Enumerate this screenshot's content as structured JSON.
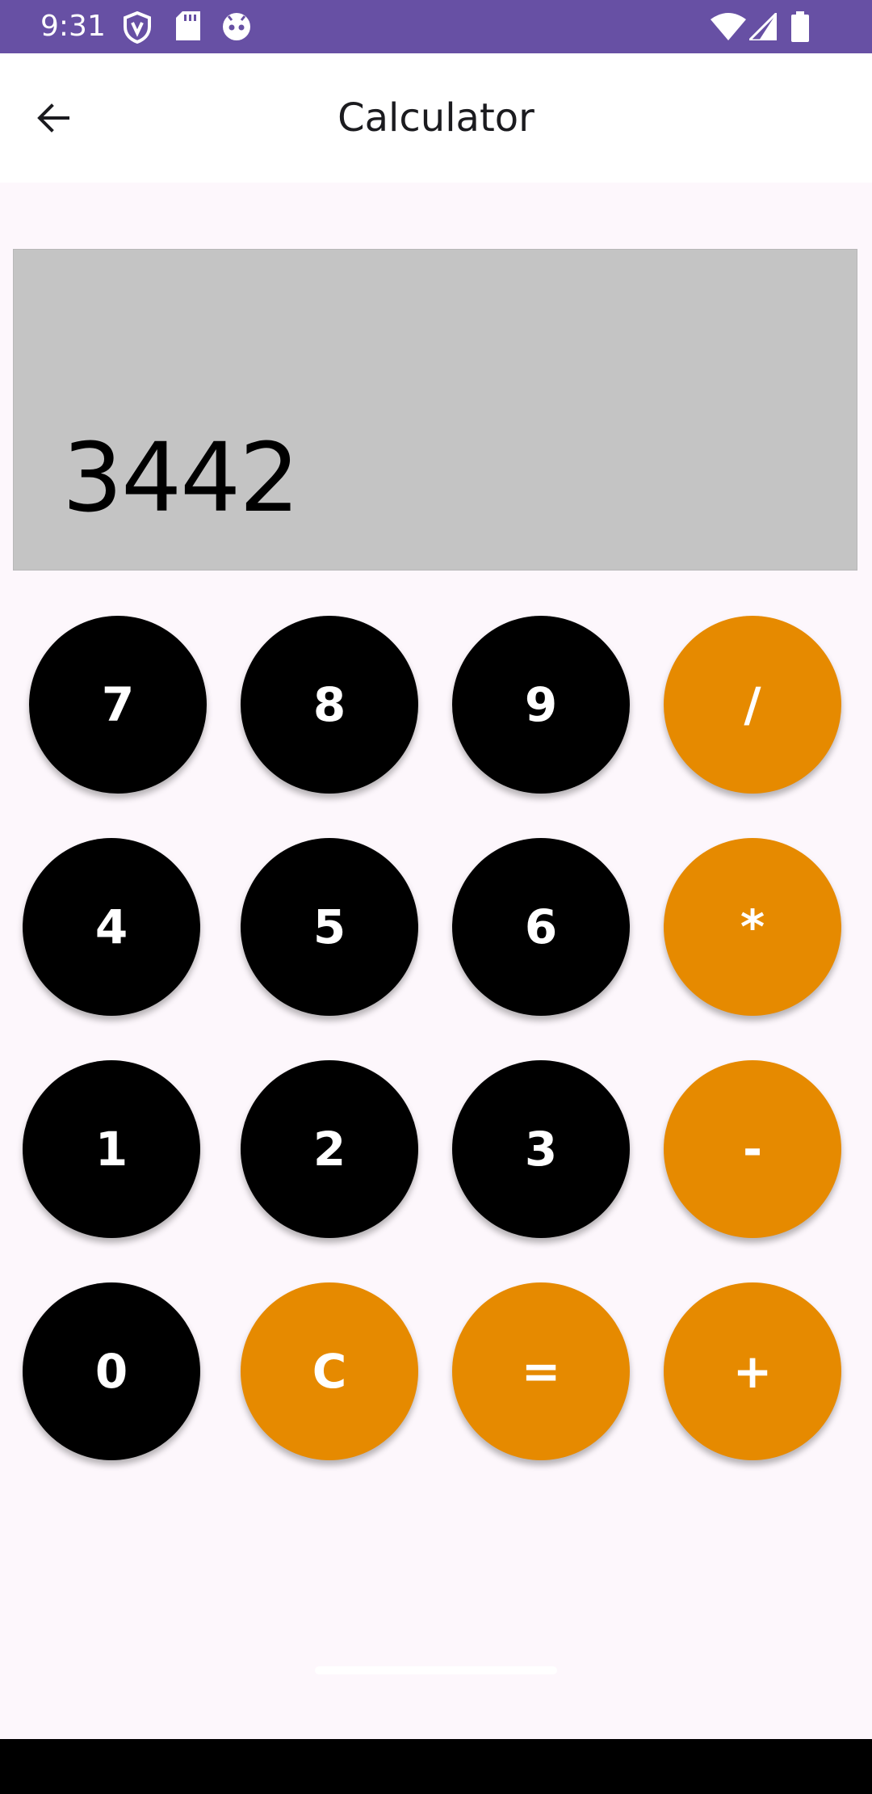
{
  "status_bar": {
    "time": "9:31",
    "left_icons": [
      "vpn-shield-icon",
      "sd-card-icon",
      "android-face-icon"
    ],
    "right_icons": [
      "wifi-icon",
      "signal-icon",
      "battery-icon"
    ],
    "background": "#6750a4"
  },
  "app_bar": {
    "title": "Calculator",
    "back_icon": "arrow-left-icon"
  },
  "display": {
    "value": "3442",
    "background": "#c4c4c4"
  },
  "keypad": {
    "colors": {
      "number": "#000000",
      "operator": "#e68a00",
      "text": "#ffffff"
    },
    "rows": [
      [
        {
          "label": "7",
          "kind": "num"
        },
        {
          "label": "8",
          "kind": "num"
        },
        {
          "label": "9",
          "kind": "num"
        },
        {
          "label": "/",
          "kind": "op"
        }
      ],
      [
        {
          "label": "4",
          "kind": "num"
        },
        {
          "label": "5",
          "kind": "num"
        },
        {
          "label": "6",
          "kind": "num"
        },
        {
          "label": "*",
          "kind": "op"
        }
      ],
      [
        {
          "label": "1",
          "kind": "num"
        },
        {
          "label": "2",
          "kind": "num"
        },
        {
          "label": "3",
          "kind": "num"
        },
        {
          "label": "-",
          "kind": "op"
        }
      ],
      [
        {
          "label": "0",
          "kind": "num"
        },
        {
          "label": "C",
          "kind": "op"
        },
        {
          "label": "=",
          "kind": "op"
        },
        {
          "label": "+",
          "kind": "op"
        }
      ]
    ]
  }
}
